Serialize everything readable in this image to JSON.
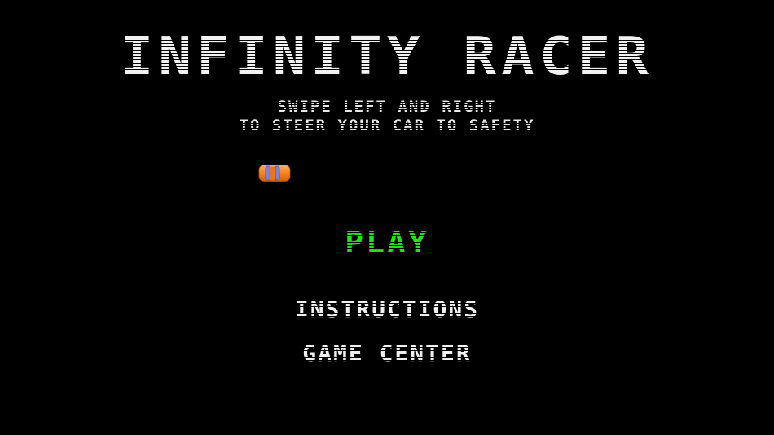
{
  "game": {
    "title": "INFINITY RACER",
    "subtitle_line1": "SWIPE LEFT AND RIGHT",
    "subtitle_line2": "TO STEER YOUR CAR TO SAFETY"
  },
  "menu": {
    "play_label": "PLAY",
    "instructions_label": "INSTRUCTIONS",
    "game_center_label": "GAME CENTER"
  },
  "colors": {
    "background": "#000000",
    "text": "#f2f2f2",
    "play": "#22e01a",
    "car_body": "#f5841f",
    "car_window": "#7b7fe0"
  },
  "player_car": {
    "icon": "car-icon",
    "orientation": "horizontal"
  }
}
